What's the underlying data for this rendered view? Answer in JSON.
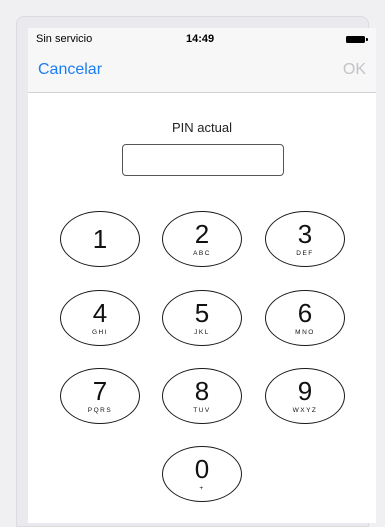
{
  "status_bar": {
    "carrier": "Sin servicio",
    "time": "14:49",
    "battery_icon": "battery-full-icon"
  },
  "nav": {
    "cancel_label": "Cancelar",
    "ok_label": "OK"
  },
  "pin": {
    "label": "PIN actual",
    "value": ""
  },
  "keypad": [
    {
      "digit": "1",
      "letters": ""
    },
    {
      "digit": "2",
      "letters": "ABC"
    },
    {
      "digit": "3",
      "letters": "DEF"
    },
    {
      "digit": "4",
      "letters": "GHI"
    },
    {
      "digit": "5",
      "letters": "JKL"
    },
    {
      "digit": "6",
      "letters": "MNO"
    },
    {
      "digit": "7",
      "letters": "PQRS"
    },
    {
      "digit": "8",
      "letters": "TUV"
    },
    {
      "digit": "9",
      "letters": "WXYZ"
    },
    {
      "digit": "0",
      "letters": "+"
    }
  ],
  "colors": {
    "accent": "#1a7ef2",
    "disabled": "#c4c4c8"
  }
}
